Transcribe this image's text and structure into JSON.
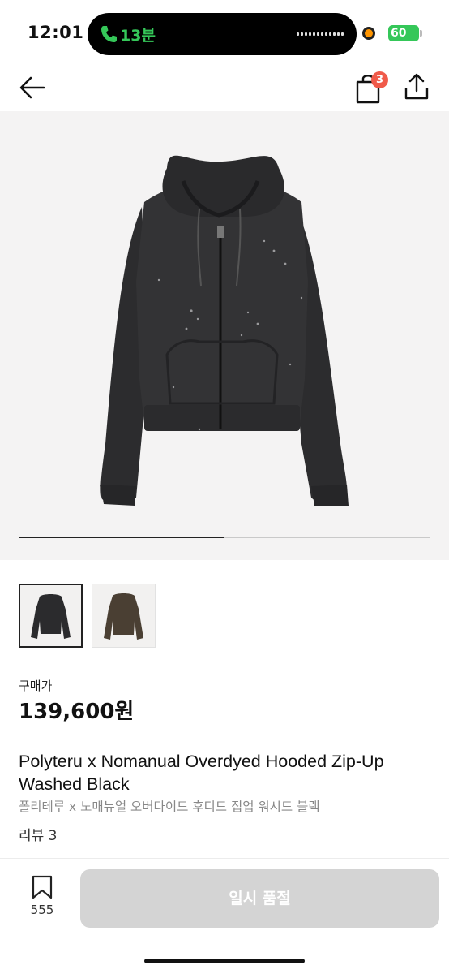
{
  "status_bar": {
    "time": "12:01",
    "call_duration": "13분",
    "battery": "60"
  },
  "nav": {
    "cart_count": "3"
  },
  "gallery": {
    "progress": 0.5,
    "thumbnails": [
      "black hoodie",
      "brown hoodie"
    ]
  },
  "product": {
    "price_label": "구매가",
    "price": "139,600원",
    "title_en": "Polyteru x Nomanual Overdyed Hooded Zip-Up Washed Black",
    "title_ko": "폴리테루 x 노매뉴얼 오버다이드 후디드 집업 워시드 블랙",
    "review_link": "리뷰 3"
  },
  "bottom_bar": {
    "wish_count": "555",
    "soldout_label": "일시 품절"
  },
  "colors": {
    "badge": "#f05a4a",
    "call_green": "#35c759",
    "disabled_button": "#d4d4d4"
  }
}
